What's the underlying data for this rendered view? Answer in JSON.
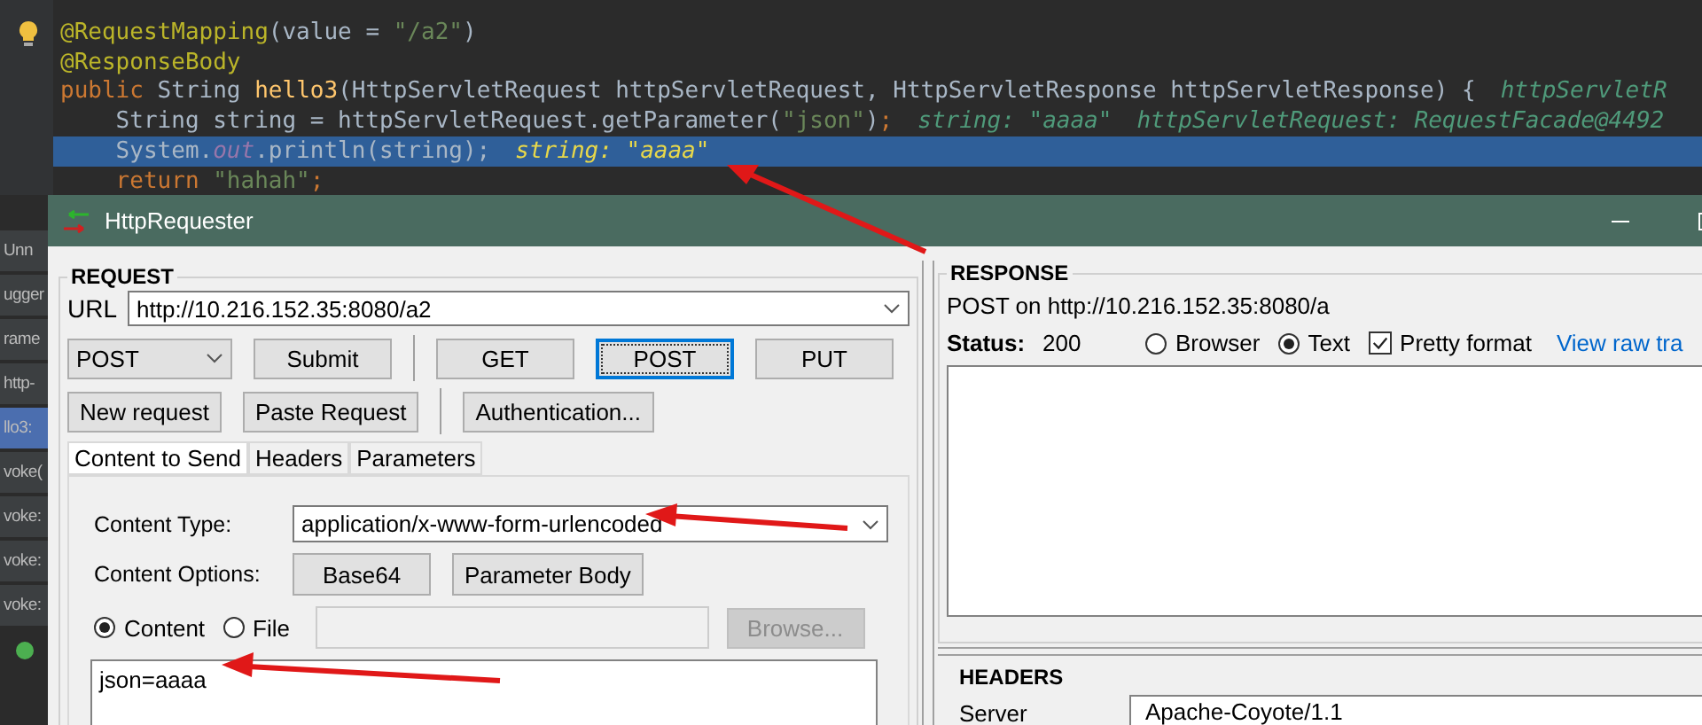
{
  "editor": {
    "lines": [
      {
        "selected": false,
        "bulb": true,
        "code": [
          {
            "kind": "annotation",
            "text": "@RequestMapping"
          },
          {
            "kind": "plain",
            "text": "(value = "
          },
          {
            "kind": "string",
            "text": "\"/a2\""
          },
          {
            "kind": "plain",
            "text": ")"
          }
        ]
      },
      {
        "selected": false,
        "code": [
          {
            "kind": "annotation",
            "text": "@ResponseBody"
          }
        ]
      },
      {
        "selected": false,
        "code": [
          {
            "kind": "keyword",
            "text": "public "
          },
          {
            "kind": "plain",
            "text": "String "
          },
          {
            "kind": "method",
            "text": "hello3"
          },
          {
            "kind": "plain",
            "text": "(HttpServletRequest httpServletRequest, HttpServletResponse httpServletResponse) {"
          }
        ],
        "hints": [
          "httpServletR"
        ]
      },
      {
        "selected": false,
        "code": [
          {
            "kind": "plain",
            "text": "    String string = httpServletRequest.getParameter("
          },
          {
            "kind": "string",
            "text": "\"json\""
          },
          {
            "kind": "plain",
            "text": ")"
          },
          {
            "kind": "keyword",
            "text": ";"
          }
        ],
        "hints": [
          "string: \"aaaa\"",
          "httpServletRequest: RequestFacade@4492"
        ]
      },
      {
        "selected": true,
        "code": [
          {
            "kind": "plain",
            "text": "    System."
          },
          {
            "kind": "field",
            "text": "out"
          },
          {
            "kind": "plain",
            "text": ".println(string);"
          }
        ],
        "hints": [
          "string: \"aaaa\""
        ]
      },
      {
        "selected": false,
        "code": [
          {
            "kind": "keyword",
            "text": "    return "
          },
          {
            "kind": "string",
            "text": "\"hahah\""
          },
          {
            "kind": "keyword",
            "text": ";"
          }
        ]
      }
    ]
  },
  "debug_panel": {
    "items": [
      {
        "text": "Unn",
        "selected": false
      },
      {
        "text": "ugger",
        "selected": false
      },
      {
        "text": "rame",
        "selected": false
      },
      {
        "text": "http-",
        "selected": false
      },
      {
        "text": "llo3:",
        "selected": true
      },
      {
        "text": "voke(",
        "selected": false
      },
      {
        "text": "voke:",
        "selected": false
      },
      {
        "text": "voke:",
        "selected": false
      },
      {
        "text": "voke:",
        "selected": false
      }
    ]
  },
  "window": {
    "title": "HttpRequester"
  },
  "request": {
    "title": "REQUEST",
    "url_label": "URL",
    "url": "http://10.216.152.35:8080/a2",
    "method": "POST",
    "submit": "Submit",
    "method_buttons": [
      {
        "label": "GET",
        "focused": false
      },
      {
        "label": "POST",
        "focused": true
      },
      {
        "label": "PUT",
        "focused": false
      }
    ],
    "new_request": "New request",
    "paste_request": "Paste Request",
    "authentication": "Authentication...",
    "tabs": [
      {
        "label": "Content to Send",
        "selected": true
      },
      {
        "label": "Headers",
        "selected": false
      },
      {
        "label": "Parameters",
        "selected": false
      }
    ],
    "content_type_label": "Content Type:",
    "content_type": "application/x-www-form-urlencoded",
    "content_options_label": "Content Options:",
    "content_options": [
      "Base64",
      "Parameter Body"
    ],
    "sources": [
      {
        "label": "Content",
        "selected": true
      },
      {
        "label": "File",
        "selected": false
      }
    ],
    "browse": {
      "label": "Browse...",
      "disabled": true
    },
    "body": "json=aaaa"
  },
  "response": {
    "title": "RESPONSE",
    "summary": "POST on http://10.216.152.35:8080/a",
    "status_label": "Status:",
    "status": "200",
    "views": [
      {
        "label": "Browser",
        "selected": false
      },
      {
        "label": "Text",
        "selected": true
      }
    ],
    "pretty": {
      "label": "Pretty format",
      "checked": true
    },
    "raw_link": "View raw tra",
    "headers_title": "HEADERS",
    "headers": [
      {
        "name": "Server",
        "value": "Apache-Coyote/1.1"
      }
    ]
  }
}
